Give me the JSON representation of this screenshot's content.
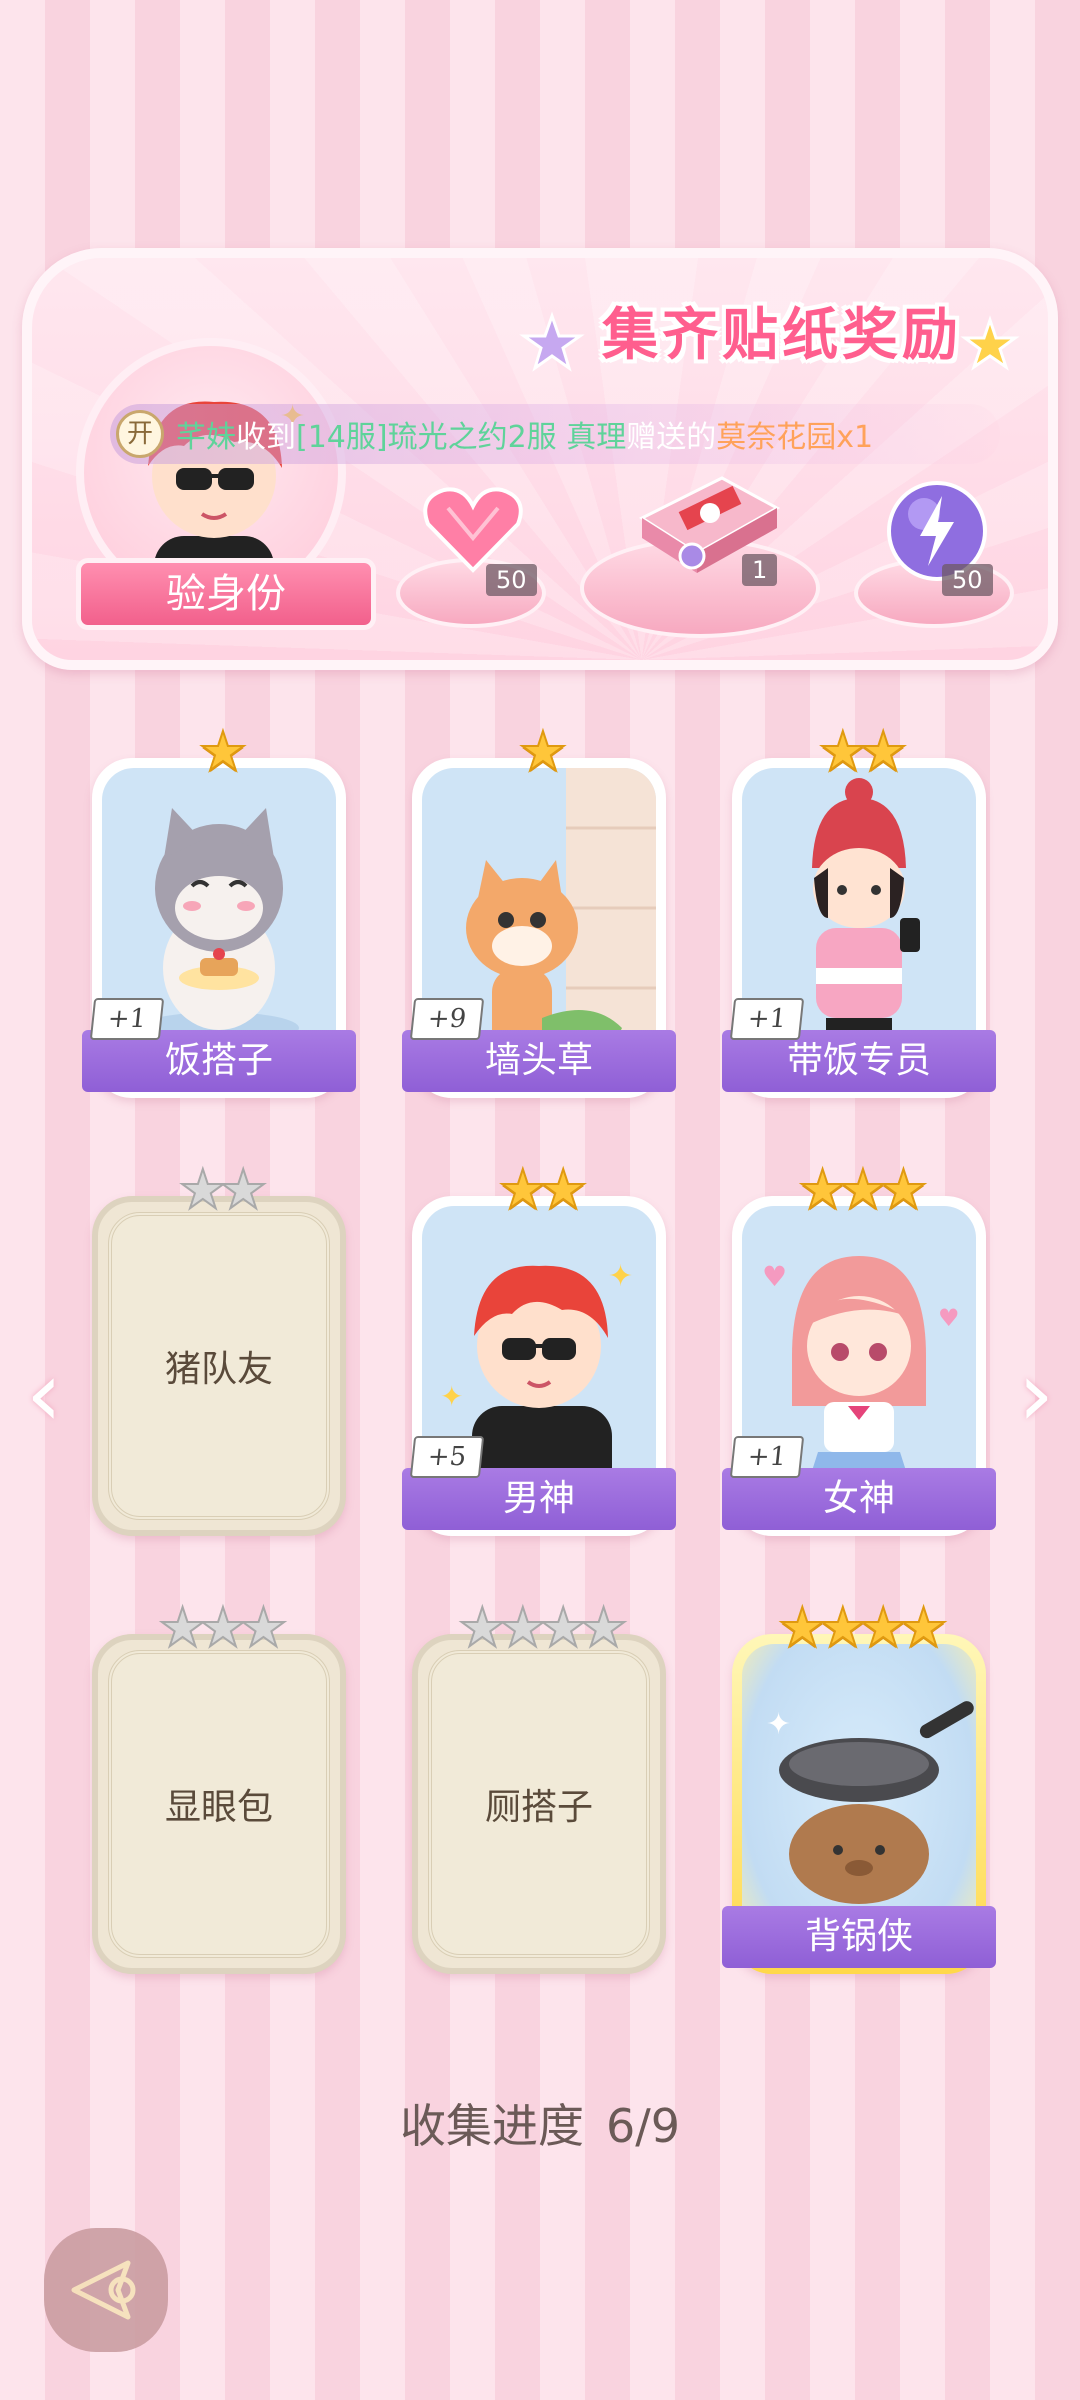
{
  "banner": {
    "title": "集齐贴纸奖励",
    "verify_label": "验身份",
    "ticker": {
      "badge": "开",
      "user": "芊妹",
      "verb": "收到",
      "target": "[14服]琉光之约2服 真理",
      "gift_verb": "赠送的",
      "gift": "莫奈花园x1"
    },
    "rewards": [
      {
        "icon": "heart-gem-icon",
        "count": "50"
      },
      {
        "icon": "gift-box-icon",
        "count": "1"
      },
      {
        "icon": "energy-orb-icon",
        "count": "50"
      }
    ]
  },
  "cards": [
    {
      "name": "饭搭子",
      "stars": 1,
      "count": "+1",
      "unlocked": true
    },
    {
      "name": "墙头草",
      "stars": 1,
      "count": "+9",
      "unlocked": true
    },
    {
      "name": "带饭专员",
      "stars": 2,
      "count": "+1",
      "unlocked": true
    },
    {
      "name": "猪队友",
      "stars": 2,
      "count": "",
      "unlocked": false
    },
    {
      "name": "男神",
      "stars": 2,
      "count": "+5",
      "unlocked": true
    },
    {
      "name": "女神",
      "stars": 3,
      "count": "+1",
      "unlocked": true
    },
    {
      "name": "显眼包",
      "stars": 3,
      "count": "",
      "unlocked": false
    },
    {
      "name": "厕搭子",
      "stars": 4,
      "count": "",
      "unlocked": false
    },
    {
      "name": "背锅侠",
      "stars": 4,
      "count": "",
      "unlocked": true
    }
  ],
  "progress": {
    "label": "收集进度",
    "value": "6/9",
    "collected": 6,
    "total": 9
  },
  "colors": {
    "accent_pink": "#ff5e8e",
    "ribbon_purple": "#9a6adc",
    "star_gold": "#ffc63a",
    "star_grey": "#d9d9d9"
  }
}
